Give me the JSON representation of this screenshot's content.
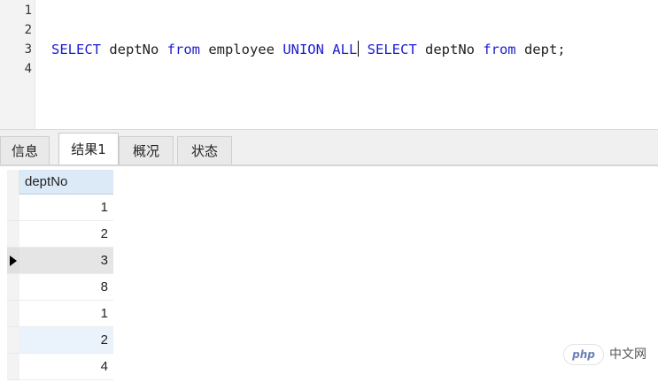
{
  "editor": {
    "line_numbers": [
      "1",
      "2",
      "3",
      "4"
    ],
    "line3_tokens": [
      {
        "text": "SELECT",
        "kind": "kw"
      },
      {
        "text": " deptNo ",
        "kind": "plain"
      },
      {
        "text": "from",
        "kind": "kw"
      },
      {
        "text": " employee ",
        "kind": "plain"
      },
      {
        "text": "UNION ALL",
        "kind": "kw"
      },
      {
        "text": " ",
        "kind": "plain"
      },
      {
        "text": "SELECT",
        "kind": "kw"
      },
      {
        "text": " deptNo ",
        "kind": "plain"
      },
      {
        "text": "from",
        "kind": "kw"
      },
      {
        "text": " dept;",
        "kind": "plain"
      }
    ]
  },
  "tabs": [
    {
      "label": "信息",
      "active": false
    },
    {
      "label": "结果1",
      "active": true
    },
    {
      "label": "概况",
      "active": false
    },
    {
      "label": "状态",
      "active": false
    }
  ],
  "grid": {
    "column_header": "deptNo",
    "rows": [
      "1",
      "2",
      "3",
      "8",
      "1",
      "2",
      "4"
    ],
    "selected_row": 2
  },
  "watermark": {
    "logo_text": "php",
    "site_text": "中文网"
  },
  "colors": {
    "keyword": "#1c1cd0",
    "header_bg": "#dce9f6"
  }
}
